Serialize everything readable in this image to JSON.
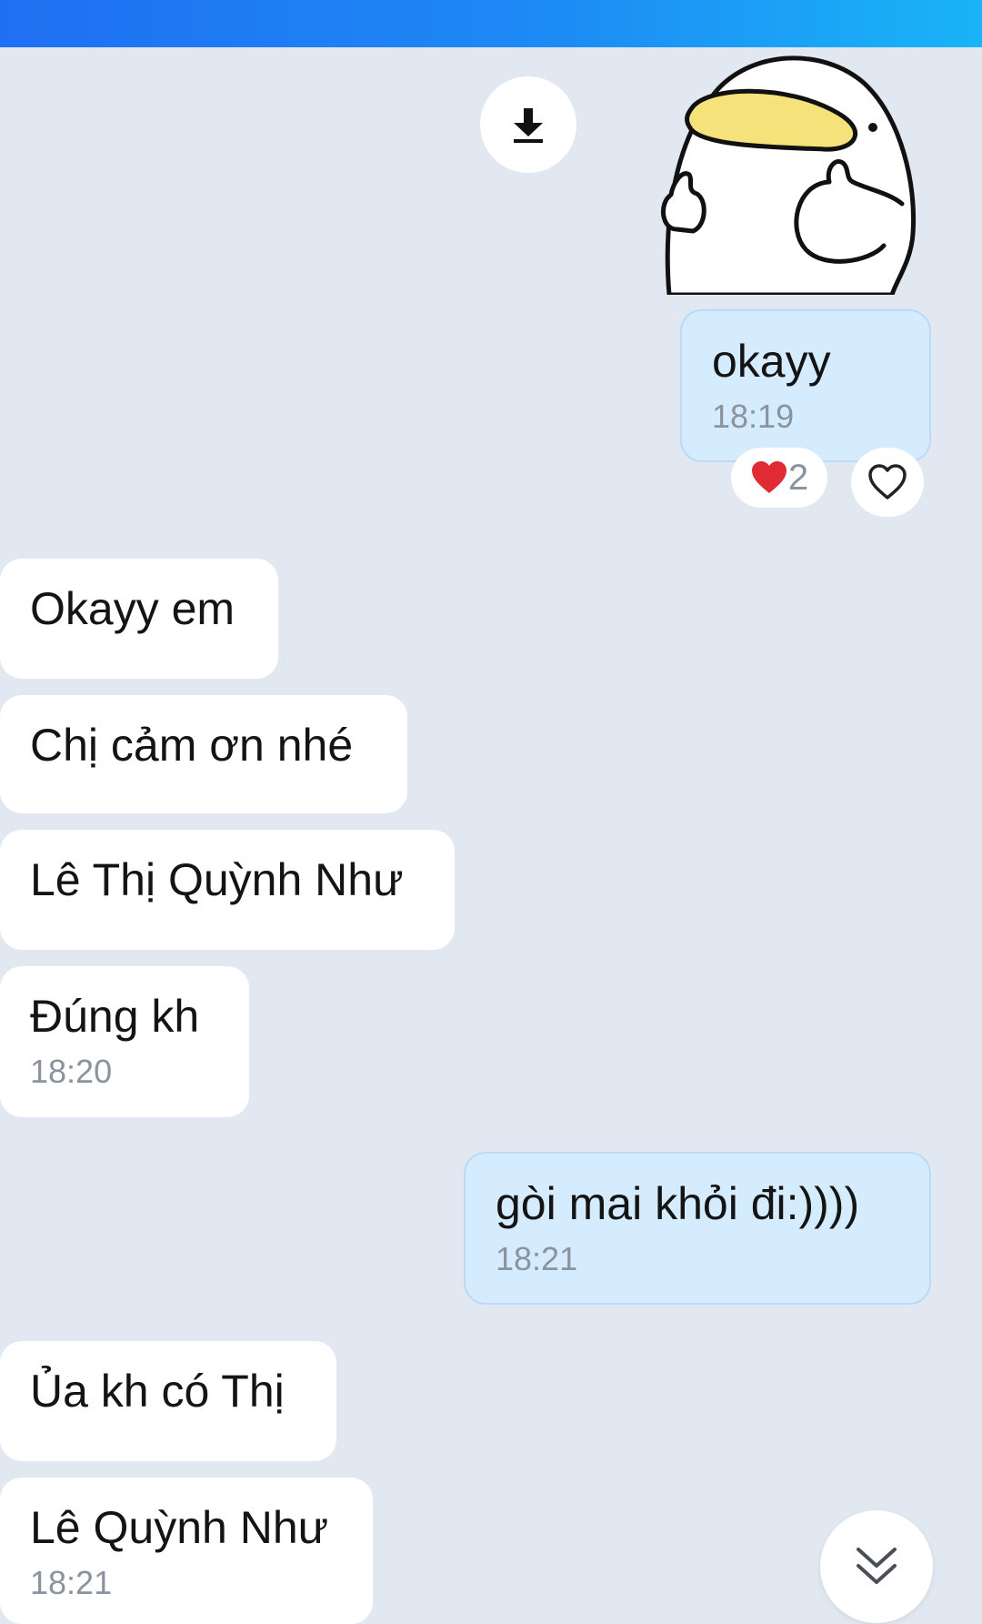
{
  "header": {
    "accent_color": "#1f6ff2"
  },
  "sticker": {
    "icon": "duck-thumbs-up-sticker",
    "download_icon": "download-icon"
  },
  "messages": [
    {
      "text": "okayy",
      "time": "18:19",
      "sender": "me"
    },
    {
      "text": "Okayy em",
      "time": "",
      "sender": "other"
    },
    {
      "text": "Chị cảm ơn nhé",
      "time": "",
      "sender": "other"
    },
    {
      "text": "Lê Thị Quỳnh Như",
      "time": "",
      "sender": "other"
    },
    {
      "text": "Đúng kh",
      "time": "18:20",
      "sender": "other"
    },
    {
      "text": "gòi mai khỏi đi:))))",
      "time": "18:21",
      "sender": "me"
    },
    {
      "text": "Ủa kh có Thị",
      "time": "",
      "sender": "other"
    },
    {
      "text": "Lê Quỳnh Như",
      "time": "18:21",
      "sender": "other"
    }
  ],
  "reactions": {
    "icon": "heart-icon",
    "count": "2",
    "like_icon": "heart-outline-icon"
  },
  "scroll_button": {
    "icon": "double-chevron-down-icon"
  },
  "colors": {
    "background": "#e2e8f1",
    "my_bubble": "#d4ecfd",
    "other_bubble": "#ffffff",
    "time_text": "#8a939e"
  }
}
